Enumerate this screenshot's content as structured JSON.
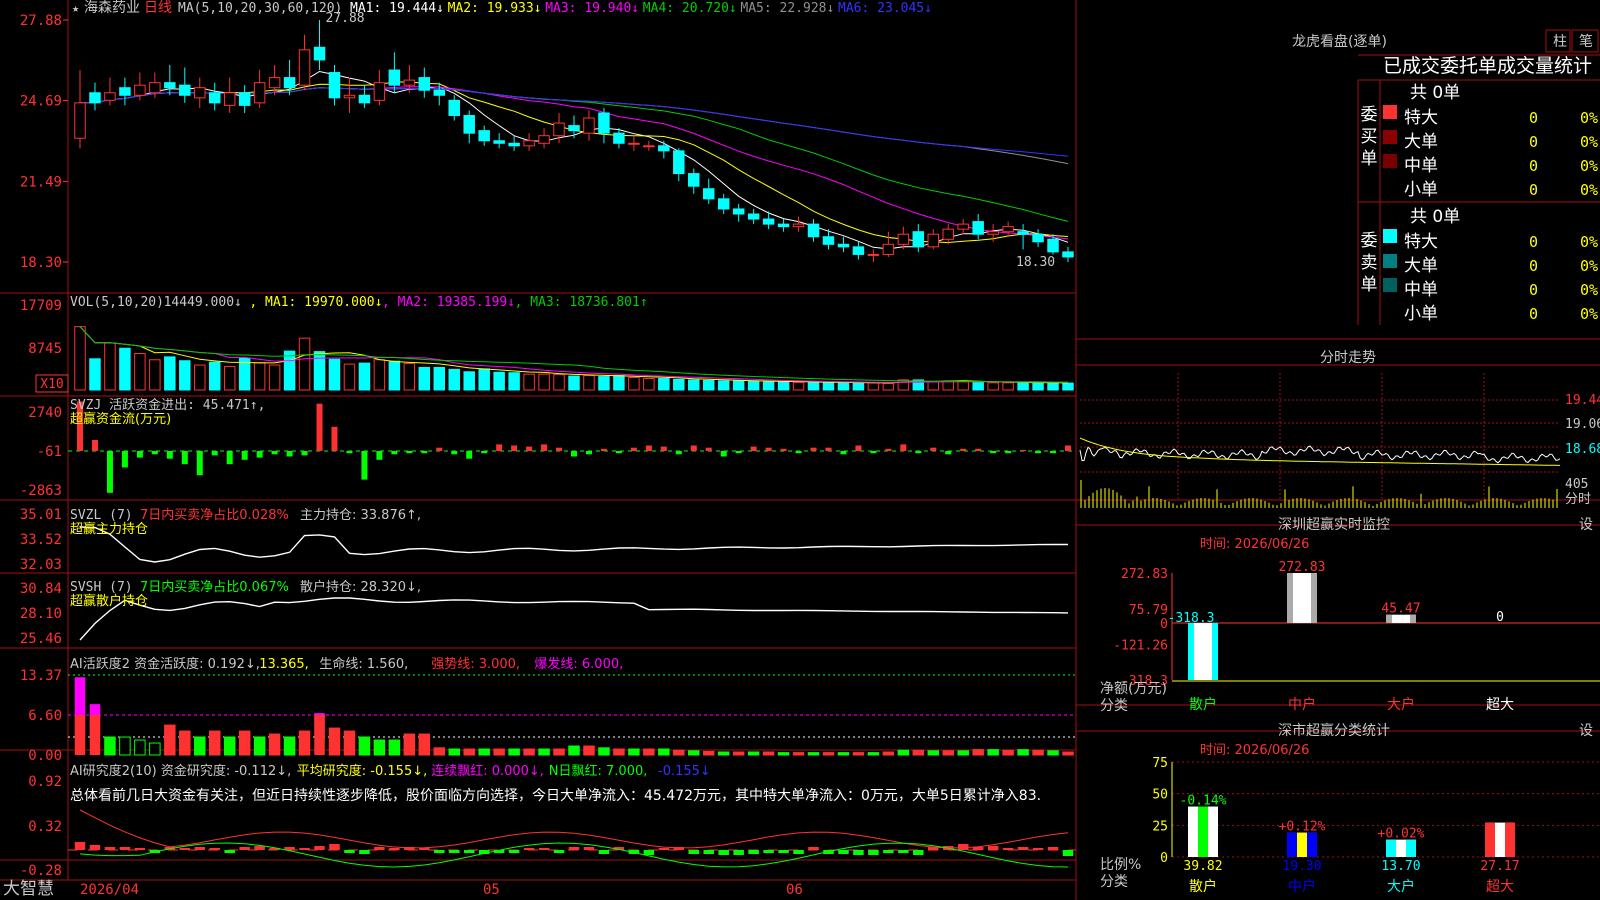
{
  "colors": {
    "up": "#ff3232",
    "down": "#00ffff",
    "grid": "#a01010",
    "ma1": "#ffffff",
    "ma2": "#ffff00",
    "ma3": "#ff00ff",
    "ma4": "#00cc00",
    "ma5": "#909090",
    "ma6": "#3333ff",
    "text": "#c8c8c8",
    "yellow": "#ffff00",
    "magenta": "#ff00ff",
    "green": "#00ff00",
    "red": "#ff3232"
  },
  "main": {
    "stock_name": "海森药业",
    "period": "日线",
    "ma_label": "MA(5,10,20,30,60,120)",
    "ma_vals": [
      {
        "k": "MA1",
        "v": "19.444"
      },
      {
        "k": "MA2",
        "v": "19.933"
      },
      {
        "k": "MA3",
        "v": "19.940"
      },
      {
        "k": "MA4",
        "v": "20.720"
      },
      {
        "k": "MA5",
        "v": "22.928"
      },
      {
        "k": "MA6",
        "v": "23.045"
      }
    ],
    "high_label": "27.88",
    "low_label": "18.30",
    "yticks": [
      "27.88",
      "24.69",
      "21.49",
      "18.30"
    ]
  },
  "vol": {
    "label": "VOL(5,10,20)",
    "vol_value": "14449.000",
    "ma1": "19970.000",
    "ma2": "19385.199",
    "ma3": "18736.801",
    "yticks": [
      "17709",
      "8745"
    ],
    "unit": "X10"
  },
  "svzj": {
    "name": "SVZJ",
    "desc": "活跃资金进出:",
    "value": "45.471",
    "sub": "超赢资金流(万元)",
    "yticks": [
      "2740",
      "-61",
      "-2863"
    ]
  },
  "svzl": {
    "name": "SVZL (7)",
    "desc1": "7日内买卖净占比0.028%",
    "desc2": "主力持仓:",
    "value": "33.876",
    "sub": "超赢主力持仓",
    "yticks": [
      "35.01",
      "33.52",
      "32.03"
    ]
  },
  "svsh": {
    "name": "SVSH (7)",
    "desc1": "7日内买卖净占比0.067%",
    "desc2": "散户持仓:",
    "value": "28.320",
    "sub": "超赢散户持仓",
    "yticks": [
      "30.84",
      "28.10",
      "25.46"
    ]
  },
  "active": {
    "name": "AI活跃度2",
    "desc": "资金活跃度:",
    "v1": "0.192",
    "v2": "13.365",
    "life": "生命线:",
    "v3": "1.560",
    "strong": "强势线:",
    "v4": "3.000",
    "burst": "爆发线:",
    "v5": "6.000",
    "yticks": [
      "13.37",
      "6.60",
      "0.00"
    ]
  },
  "research": {
    "name": "AI研究度2(10)",
    "desc": "资金研究度:",
    "v1": "-0.112",
    "avg": "平均研究度:",
    "v2": "-0.155",
    "cont": "连续飘红:",
    "v3": "0.000",
    "nday": "N日飘红:",
    "v4": "7.000",
    "v5": "-0.155",
    "summary": "总体看前几日大资金有关注，但近日持续性逐步降低，股价面临方向选择，今日大单净流入：45.472万元，其中特大单净流入：0万元，大单5日累计净入83.",
    "yticks": [
      "0.92",
      "0.32",
      "-0.28"
    ]
  },
  "footer": {
    "brand": "大智慧",
    "date": "2026/04",
    "m05": "05",
    "m06": "06"
  },
  "right": {
    "title": "龙虎看盘(逐单)",
    "btn1": "柱",
    "btn2": "笔",
    "header": "已成交委托单成交量统计",
    "buy_label": "委买单",
    "buy_total": "共 0单",
    "sell_label": "委卖单",
    "sell_total": "共 0单",
    "rows": [
      {
        "name": "特大",
        "n": "0",
        "p": "0%"
      },
      {
        "name": "大单",
        "n": "0",
        "p": "0%"
      },
      {
        "name": "中单",
        "n": "0",
        "p": "0%"
      },
      {
        "name": "小单",
        "n": "0",
        "p": "0%"
      }
    ],
    "intraday_title": "分时走势",
    "intraday_y": [
      "19.44",
      "19.06",
      "18.68"
    ],
    "intraday_vol": "405",
    "intraday_unit": "分时",
    "sz_title": "深圳超赢实时监控",
    "sz_btn": "设",
    "time_label": "时间: 2026/06/26",
    "sz_y": [
      "272.83",
      "75.79",
      "0",
      "-121.26",
      "-318.3"
    ],
    "net_label": "净额(万元)",
    "cat_label": "分类",
    "cats": [
      "散户",
      "中户",
      "大户",
      "超大"
    ],
    "sz_bars": [
      {
        "v": -318.3,
        "lbl": "-318.3"
      },
      {
        "v": 272.83,
        "lbl": "272.83"
      },
      {
        "v": 45.47,
        "lbl": "45.47"
      },
      {
        "v": 0,
        "lbl": "0"
      }
    ],
    "cls_title": "深市超赢分类统计",
    "cls_btn": "设",
    "time_label2": "时间: 2026/06/26",
    "cls_y": [
      "75",
      "50",
      "25",
      "0"
    ],
    "ratio_label": "比例%",
    "cls_bars": [
      {
        "v": 39.82,
        "lbl": "39.82",
        "chg": "-0.14%"
      },
      {
        "v": 19.3,
        "lbl": "19.30",
        "chg": "+0.12%"
      },
      {
        "v": 13.7,
        "lbl": "13.70",
        "chg": "+0.02%"
      },
      {
        "v": 27.17,
        "lbl": "27.17",
        "chg": ""
      }
    ]
  },
  "chart_data": {
    "type": "candlestick",
    "title": "海森药业 日线",
    "ylim": [
      18.3,
      27.88
    ],
    "candles": [
      [
        23.2,
        24.6,
        25.9,
        22.8
      ],
      [
        25.0,
        24.6,
        25.4,
        24.3
      ],
      [
        24.7,
        25.0,
        25.6,
        24.5
      ],
      [
        25.2,
        24.9,
        25.6,
        24.5
      ],
      [
        24.9,
        25.3,
        25.8,
        24.7
      ],
      [
        25.0,
        25.4,
        25.8,
        24.8
      ],
      [
        25.4,
        25.2,
        26.1,
        24.9
      ],
      [
        25.3,
        24.9,
        26.0,
        24.6
      ],
      [
        24.8,
        25.2,
        25.6,
        24.4
      ],
      [
        25.0,
        24.6,
        25.4,
        24.3
      ],
      [
        24.5,
        25.0,
        25.6,
        24.2
      ],
      [
        25.0,
        24.5,
        25.3,
        24.2
      ],
      [
        24.6,
        25.4,
        25.9,
        24.4
      ],
      [
        25.2,
        25.6,
        26.1,
        24.9
      ],
      [
        25.6,
        25.2,
        26.3,
        24.9
      ],
      [
        25.3,
        26.7,
        27.3,
        25.1
      ],
      [
        26.8,
        26.3,
        27.88,
        25.9
      ],
      [
        25.8,
        24.8,
        26.1,
        24.5
      ],
      [
        24.8,
        24.9,
        25.6,
        24.2
      ],
      [
        24.9,
        24.6,
        25.3,
        24.4
      ],
      [
        24.7,
        25.4,
        25.9,
        24.5
      ],
      [
        25.9,
        25.3,
        26.6,
        25.0
      ],
      [
        25.3,
        25.5,
        26.1,
        25.0
      ],
      [
        25.6,
        25.1,
        26.0,
        24.8
      ],
      [
        25.1,
        24.9,
        25.4,
        24.5
      ],
      [
        24.7,
        24.1,
        24.9,
        23.9
      ],
      [
        24.1,
        23.4,
        24.3,
        23.0
      ],
      [
        23.5,
        23.1,
        23.7,
        22.9
      ],
      [
        23.1,
        23.0,
        23.4,
        22.8
      ],
      [
        23.0,
        22.9,
        23.3,
        22.7
      ],
      [
        22.9,
        23.1,
        23.4,
        22.7
      ],
      [
        23.0,
        23.3,
        23.6,
        22.8
      ],
      [
        23.3,
        23.8,
        24.2,
        23.0
      ],
      [
        23.7,
        23.5,
        24.1,
        23.2
      ],
      [
        23.4,
        24.0,
        24.3,
        23.1
      ],
      [
        24.2,
        23.4,
        24.4,
        23.0
      ],
      [
        23.4,
        23.0,
        23.6,
        22.8
      ],
      [
        23.0,
        23.0,
        23.3,
        22.7
      ],
      [
        22.9,
        22.9,
        23.1,
        22.7
      ],
      [
        22.9,
        22.7,
        23.1,
        22.4
      ],
      [
        22.7,
        21.8,
        22.8,
        21.5
      ],
      [
        21.8,
        21.3,
        22.0,
        21.0
      ],
      [
        21.2,
        20.8,
        21.6,
        20.6
      ],
      [
        20.8,
        20.4,
        21.0,
        20.2
      ],
      [
        20.4,
        20.2,
        20.6,
        19.9
      ],
      [
        20.2,
        20.0,
        20.4,
        19.8
      ],
      [
        20.0,
        19.8,
        20.3,
        19.6
      ],
      [
        19.8,
        19.7,
        20.0,
        19.5
      ],
      [
        19.7,
        19.8,
        20.1,
        19.5
      ],
      [
        19.8,
        19.3,
        20.0,
        19.1
      ],
      [
        19.3,
        19.0,
        19.6,
        18.8
      ],
      [
        19.0,
        18.9,
        19.3,
        18.7
      ],
      [
        18.9,
        18.6,
        19.1,
        18.4
      ],
      [
        18.6,
        18.6,
        18.8,
        18.3
      ],
      [
        18.6,
        19.0,
        19.5,
        18.5
      ],
      [
        19.0,
        19.4,
        19.7,
        18.8
      ],
      [
        19.5,
        18.9,
        19.8,
        18.7
      ],
      [
        18.9,
        19.4,
        19.6,
        18.8
      ],
      [
        19.2,
        19.6,
        19.8,
        19.0
      ],
      [
        19.6,
        19.8,
        20.0,
        19.4
      ],
      [
        19.9,
        19.4,
        20.2,
        19.2
      ],
      [
        19.4,
        19.5,
        19.8,
        19.1
      ],
      [
        19.5,
        19.7,
        19.9,
        19.3
      ],
      [
        19.5,
        19.4,
        19.8,
        18.8
      ],
      [
        19.4,
        19.1,
        19.6,
        18.9
      ],
      [
        19.2,
        18.7,
        19.4,
        18.6
      ],
      [
        18.7,
        18.5,
        18.9,
        18.3
      ]
    ],
    "ma_series": [
      {
        "name": "MA1",
        "last": 19.444
      },
      {
        "name": "MA2",
        "last": 19.933
      },
      {
        "name": "MA3",
        "last": 19.94
      },
      {
        "name": "MA4",
        "last": 20.72
      },
      {
        "name": "MA5",
        "last": 22.928
      },
      {
        "name": "MA6",
        "last": 23.045
      }
    ],
    "volume": [
      13200,
      6500,
      9800,
      8700,
      7600,
      6300,
      6900,
      6100,
      5200,
      5800,
      4900,
      6600,
      5700,
      5200,
      8100,
      10800,
      8000,
      6400,
      5400,
      5600,
      6300,
      6000,
      5500,
      4700,
      4700,
      4300,
      3800,
      4400,
      3700,
      3600,
      3300,
      3300,
      3200,
      2900,
      3000,
      2800,
      3000,
      2600,
      2400,
      2400,
      2200,
      2100,
      2000,
      1900,
      1900,
      1800,
      1700,
      1700,
      1600,
      1600,
      1500,
      1500,
      1500,
      1500,
      1400,
      2100,
      2100,
      1800,
      1900,
      1700,
      1600,
      1500,
      1500,
      1600,
      1500,
      1400,
      1445
    ]
  }
}
